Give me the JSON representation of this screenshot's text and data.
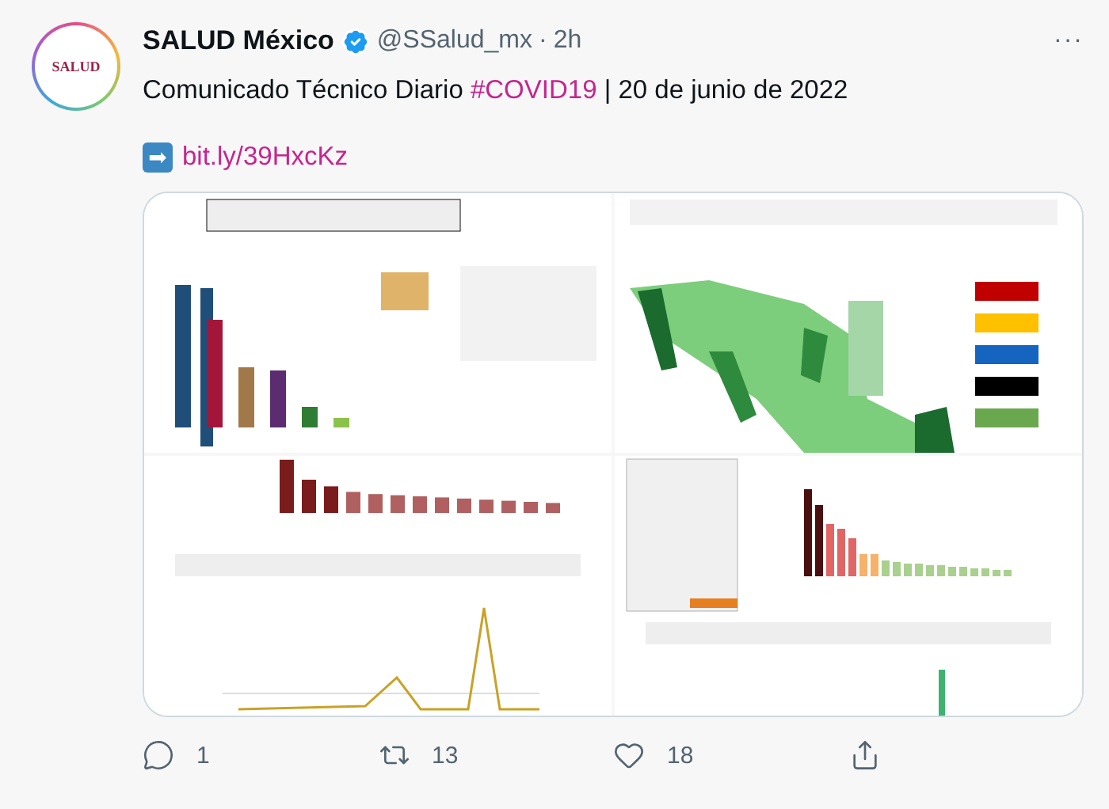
{
  "tweet": {
    "avatar_text": "SALUD",
    "author": "SALUD México",
    "verified": true,
    "handle": "@SSalud_mx",
    "separator": "·",
    "time": "2h",
    "more": "···",
    "text": [
      {
        "kind": "plain",
        "text": "Comunicado Técnico Diario "
      },
      {
        "kind": "hashtag",
        "text": "#COVID19"
      },
      {
        "kind": "plain",
        "text": " | 20 de junio de 2022"
      }
    ],
    "link": {
      "icon": "➡",
      "text": "bit.ly/39HxcKz"
    },
    "actions": [
      {
        "kind": "reply",
        "count": "1"
      },
      {
        "kind": "retweet",
        "count": "13"
      },
      {
        "kind": "like",
        "count": "18"
      },
      {
        "kind": "share"
      }
    ]
  }
}
